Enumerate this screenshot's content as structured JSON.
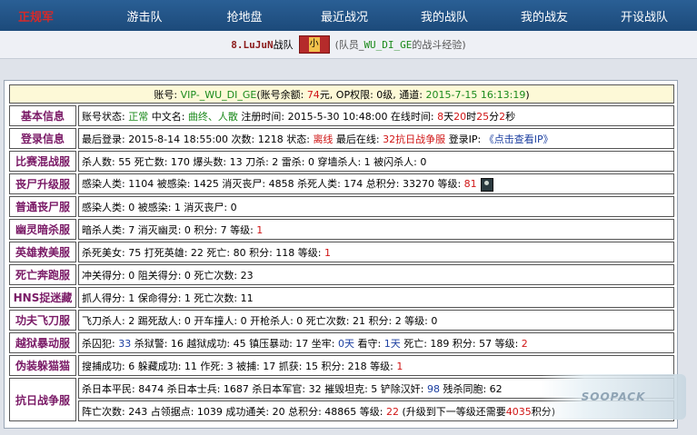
{
  "nav": {
    "brand": "正规军",
    "items": [
      "游击队",
      "抢地盘",
      "最近战况",
      "我的战队",
      "我的战友",
      "开设战队"
    ]
  },
  "subtitle": {
    "team_name": "8.LuJuN",
    "team_suffix": "战队",
    "badge_char": "小",
    "note_prefix": "(队员_",
    "note_uid": "WU_DI_GE",
    "note_suffix": "的战斗经验)"
  },
  "header": {
    "account_label": "账号: ",
    "account_value": "VIP-_WU_DI_GE",
    "balance_label": "(账号余额: ",
    "balance_value": "74",
    "balance_unit": "元, OP权限: 0级, 通道: ",
    "date": "2015-7-15 16:13:19",
    "close": ")"
  },
  "rows": {
    "basic": {
      "label": "基本信息",
      "status_label": "账号状态: ",
      "status": "正常",
      "cn_label": " 中文名: ",
      "cn_name": "曲终、人散",
      "reg_label": " 注册时间: ",
      "reg_time": "2015-5-30 10:48:00",
      "online_label": " 在线时间: ",
      "days": "8",
      "d": "天",
      "hours": "20",
      "h": "时",
      "mins": "25",
      "m": "分",
      "secs": "2",
      "s": "秒"
    },
    "login": {
      "label": "登录信息",
      "last_label": "最后登录: ",
      "last_time": "2015-8-14 18:55:00",
      "count_label": " 次数: ",
      "count": "1218",
      "state_label": " 状态: ",
      "state": "离线",
      "place_label": " 最后在线: ",
      "place": "32抗日战争服",
      "ip_label": " 登录IP: ",
      "ip_link": "《点击查看IP》"
    },
    "r1": {
      "label": "比赛混战服",
      "text": "杀人数: 55 死亡数: 170 爆头数: 13 刀杀: 2 雷杀: 0 穿墙杀人: 1 被闪杀人: 0"
    },
    "r2": {
      "label": "丧尸升级服",
      "text": "感染人类: 1104 被感染: 1425 消灭丧尸: 4858 杀死人类: 174 总积分: 33270 等级: ",
      "level": "81"
    },
    "r3": {
      "label": "普通丧尸服",
      "text": "感染人类: 0 被感染: 1 消灭丧尸: 0"
    },
    "r4": {
      "label": "幽灵暗杀服",
      "text": "暗杀人类: 7 消灭幽灵: 0 积分: 7 等级: ",
      "level": "1"
    },
    "r5": {
      "label": "英雄救美服",
      "text": "杀死美女: 75 打死英雄: 22 死亡: 80 积分: 118 等级: ",
      "level": "1"
    },
    "r6": {
      "label": "死亡奔跑服",
      "text": "冲关得分: 0 阻关得分: 0 死亡次数: 23"
    },
    "r7": {
      "label": "HNS捉迷藏",
      "text": "抓人得分: 1 保命得分: 1 死亡次数: 11"
    },
    "r8": {
      "label": "功夫飞刀服",
      "text": "飞刀杀人: 2 踢死敌人: 0 开车撞人: 0 开枪杀人: 0 死亡次数: 21 积分: 2 等级: 0"
    },
    "r9": {
      "label": "越狱暴动服",
      "p1": "杀囚犯: ",
      "v1": "33",
      "p2": " 杀狱警: 16 越狱成功: 45 镇压暴动: 17 坐牢: ",
      "v2": "0天",
      "p3": " 看守: ",
      "v3": "1天",
      "p4": " 死亡: 189 积分: 57 等级: ",
      "level": "2"
    },
    "r10": {
      "label": "伪装躲猫猫",
      "text": "搜捕成功: 6 躲藏成功: 11 作死: 3 被捕: 17 抓获: 15 积分: 218 等级: ",
      "level": "1"
    },
    "r11": {
      "label": "抗日战争服",
      "line1_a": "杀日本平民: 8474 杀日本士兵: 1687 杀日本军官: 32 摧毁坦克: 5 铲除汉奸: ",
      "line1_v": "98",
      "line1_b": " 残杀同胞: 62",
      "line2_a": "阵亡次数: 243 占领据点: 1039 成功通关: 20 总积分: 48865 等级: ",
      "line2_lv": "22",
      "line2_b": " (升级到下一等级还需要",
      "line2_need": "4035",
      "line2_c": "积分)"
    }
  },
  "watermark": "SOOPACK"
}
